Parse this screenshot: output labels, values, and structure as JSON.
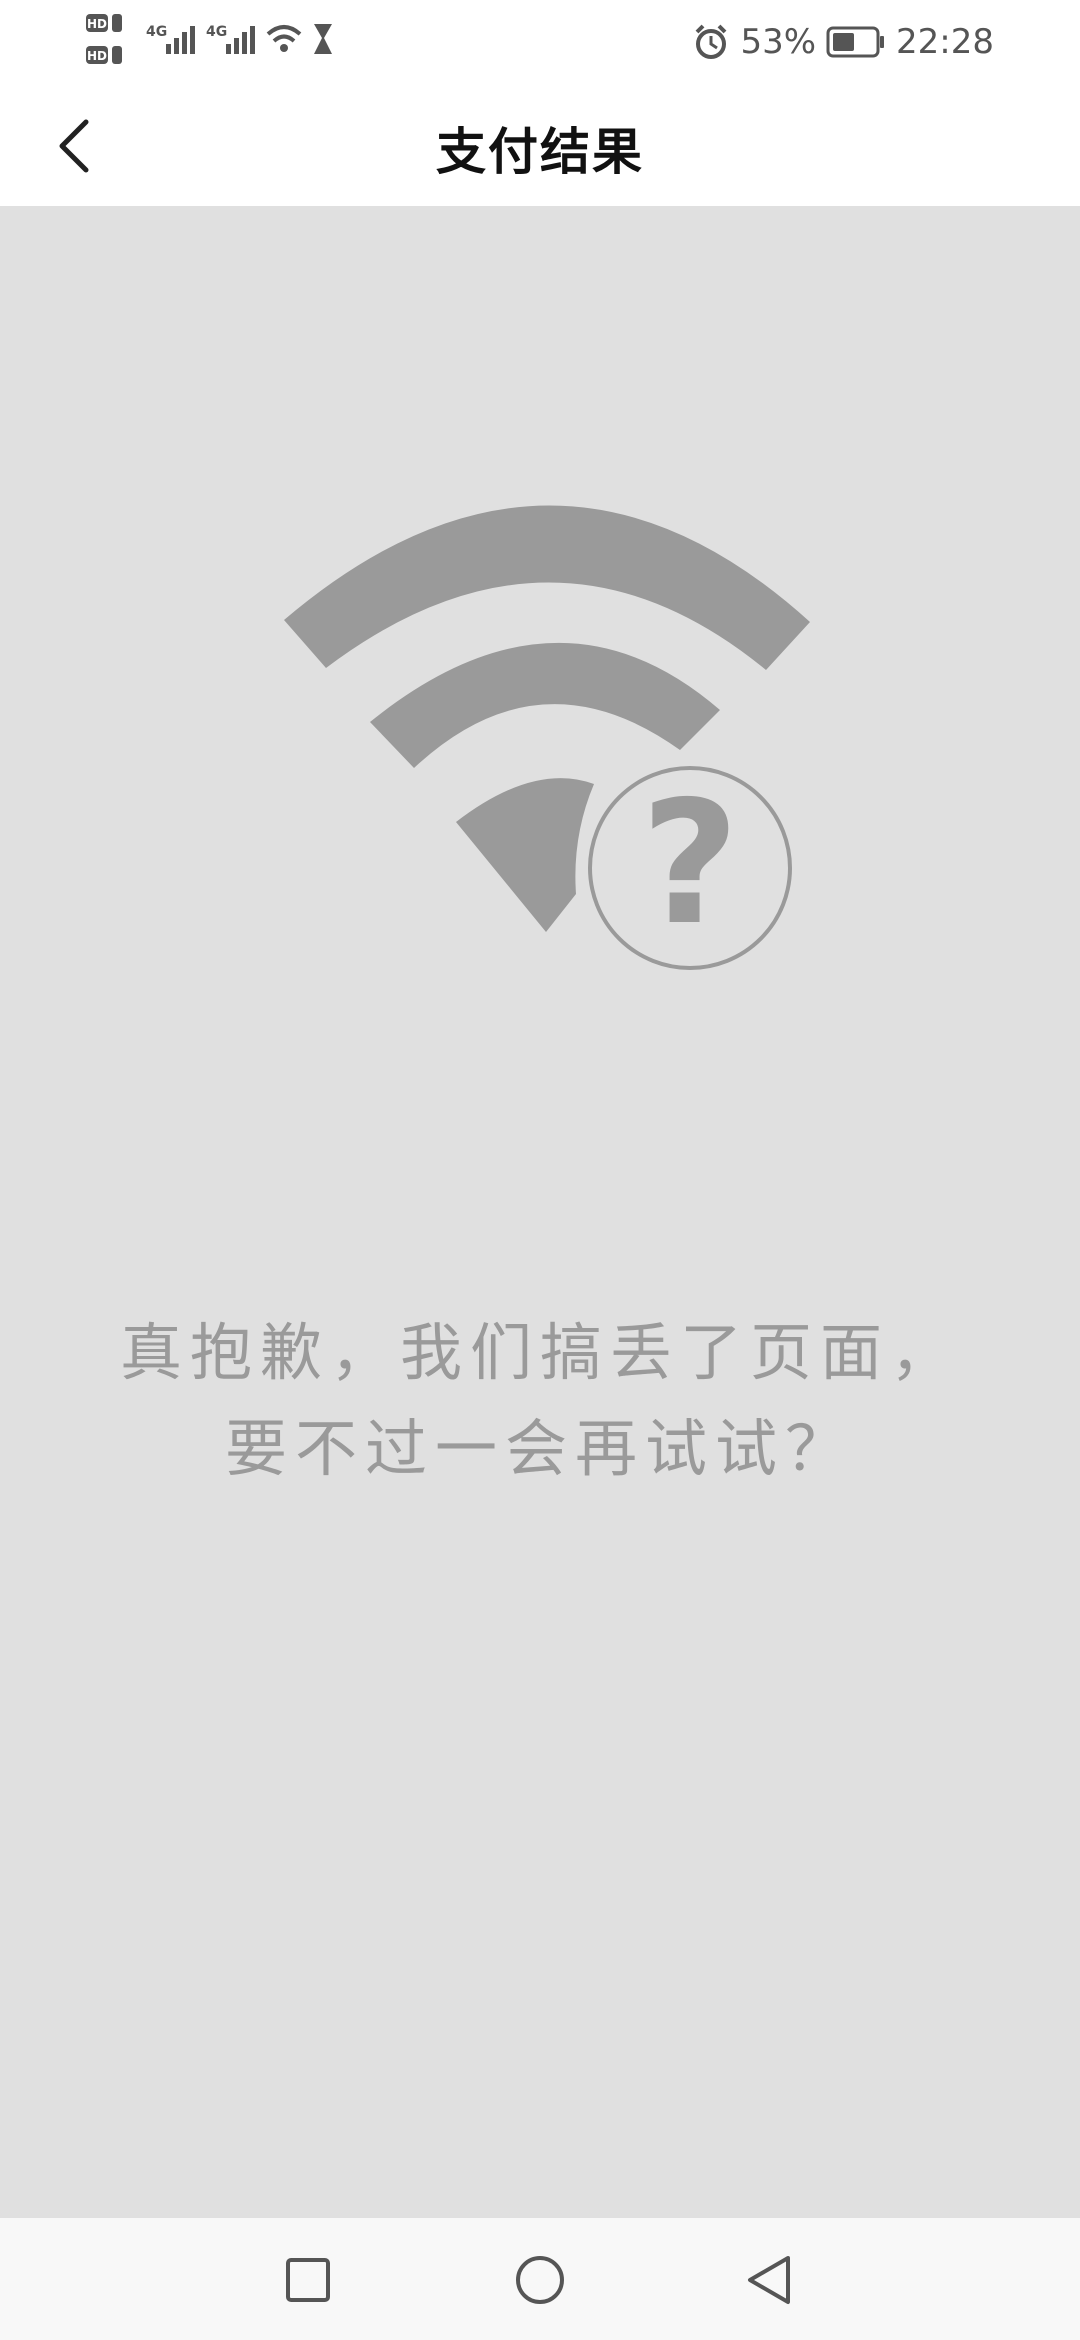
{
  "status_bar": {
    "sim1_label": "HD",
    "sim1_num": "1",
    "sim2_label": "HD",
    "sim2_num": "2",
    "network1": "4G",
    "network2": "4G",
    "battery_percent": "53%",
    "battery_level": 0.53,
    "time": "22:28",
    "icons": [
      "signal-icon",
      "wifi-icon",
      "hourglass-icon",
      "alarm-icon",
      "battery-icon"
    ]
  },
  "app_bar": {
    "title": "支付结果",
    "back_icon": "chevron-left-icon"
  },
  "error": {
    "illustration": "wifi-question-icon",
    "line1": "真抱歉，我们搞丢了页面，",
    "line2": "要不过一会再试试？"
  },
  "nav_bar": {
    "icons": [
      "recent-apps-icon",
      "home-icon",
      "back-triangle-icon"
    ]
  },
  "colors": {
    "background": "#e0e0e0",
    "illustration": "#9a9a9a",
    "text": "#9a9a9a",
    "bar": "#ffffff"
  }
}
